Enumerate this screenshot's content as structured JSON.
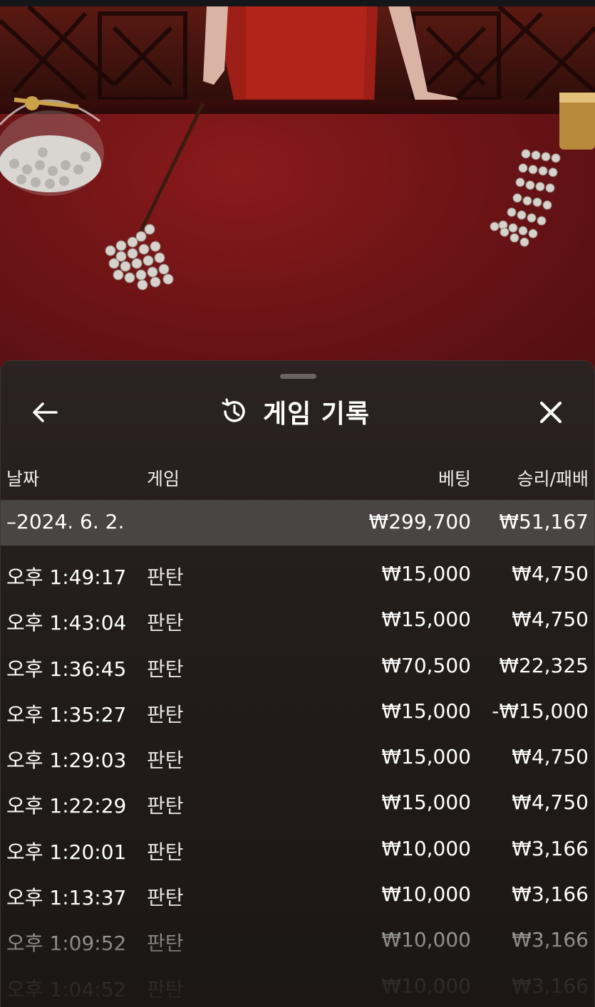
{
  "header": {
    "title": "게임 기록",
    "back_icon": "arrow-left-icon",
    "history_icon": "history-icon",
    "close_icon": "close-icon"
  },
  "table": {
    "columns": [
      "날짜",
      "게임",
      "베팅",
      "승리/패배"
    ],
    "group": {
      "date": "–2024. 6. 2.",
      "total_bet": "₩299,700",
      "total_result": "₩51,167"
    },
    "rows": [
      {
        "time": "오후 1:49:17",
        "game": "판탄",
        "bet": "₩15,000",
        "result": "₩4,750"
      },
      {
        "time": "오후 1:43:04",
        "game": "판탄",
        "bet": "₩15,000",
        "result": "₩4,750"
      },
      {
        "time": "오후 1:36:45",
        "game": "판탄",
        "bet": "₩70,500",
        "result": "₩22,325"
      },
      {
        "time": "오후 1:35:27",
        "game": "판탄",
        "bet": "₩15,000",
        "result": "-₩15,000"
      },
      {
        "time": "오후 1:29:03",
        "game": "판탄",
        "bet": "₩15,000",
        "result": "₩4,750"
      },
      {
        "time": "오후 1:22:29",
        "game": "판탄",
        "bet": "₩15,000",
        "result": "₩4,750"
      },
      {
        "time": "오후 1:20:01",
        "game": "판탄",
        "bet": "₩10,000",
        "result": "₩3,166"
      },
      {
        "time": "오후 1:13:37",
        "game": "판탄",
        "bet": "₩10,000",
        "result": "₩3,166"
      },
      {
        "time": "오후 1:09:52",
        "game": "판탄",
        "bet": "₩10,000",
        "result": "₩3,166"
      },
      {
        "time": "오후 1:04:52",
        "game": "판탄",
        "bet": "₩10,000",
        "result": "₩3,166"
      }
    ]
  },
  "colors": {
    "table_felt": "#6e1416",
    "sheet_bg": "#221c1b",
    "group_row_bg": "#4a4545"
  }
}
